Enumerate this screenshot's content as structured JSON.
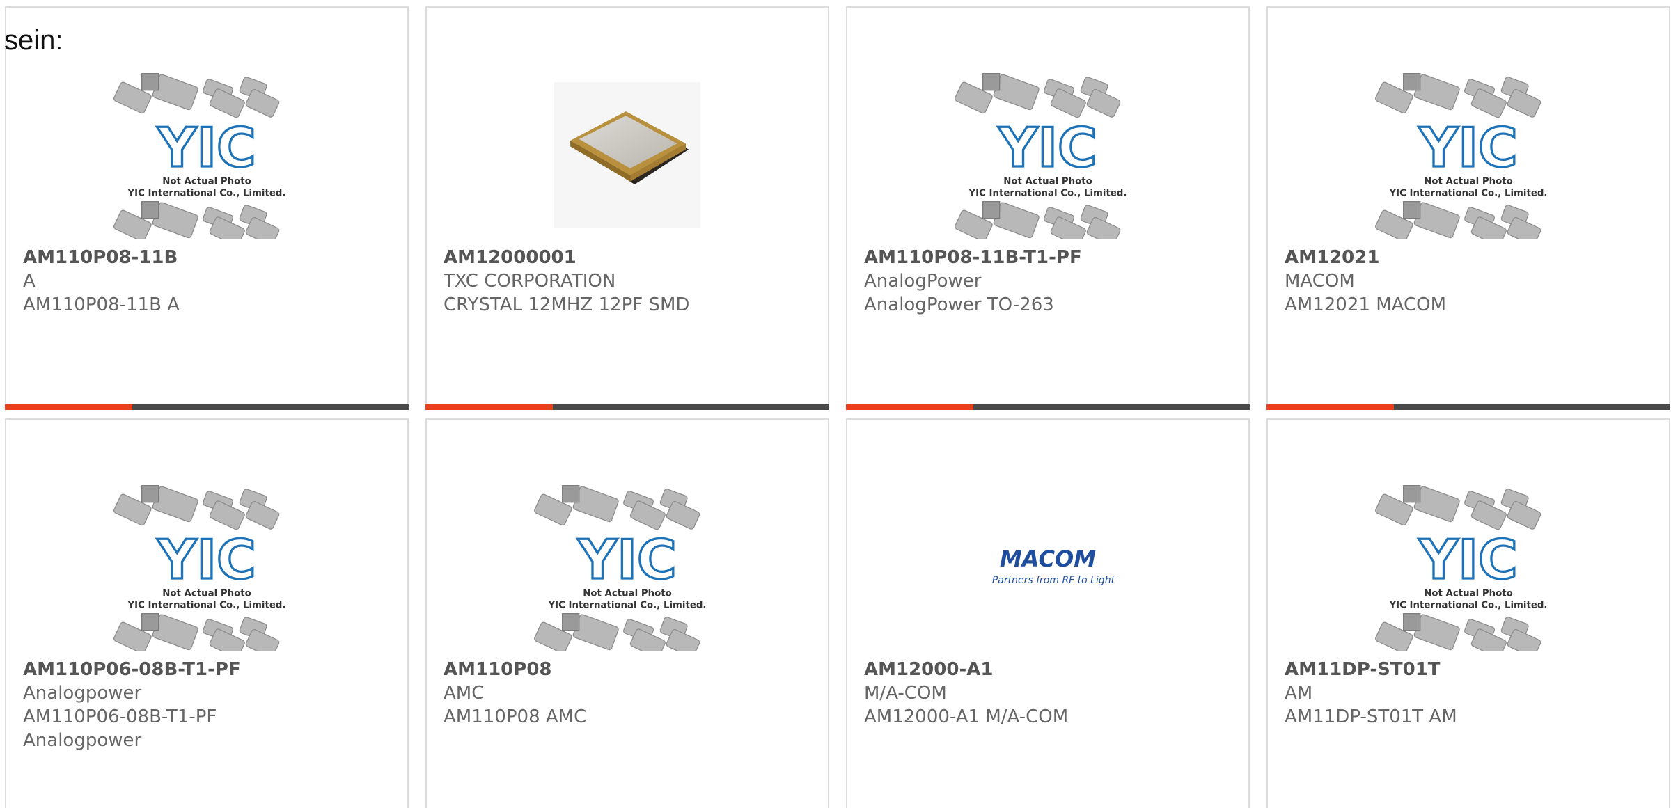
{
  "header_text": "sein:",
  "colors": {
    "accent": "#e8411c",
    "bar_dark": "#4a4a4a",
    "border": "#dcdcdc",
    "yic_blue": "#1e73b8",
    "macom_blue": "#1f4e9e"
  },
  "placeholder": {
    "line1": "Not Actual Photo",
    "line2": "YIC International Co., Limited.",
    "logo": "YIC"
  },
  "macom": {
    "name": "MACOM",
    "tagline": "Partners from RF to Light"
  },
  "products": [
    {
      "title": "AM110P08-11B",
      "line1": "A",
      "line2": "AM110P08-11B A",
      "line3": "",
      "image": "yic-placeholder"
    },
    {
      "title": "AM12000001",
      "line1": "TXC CORPORATION",
      "line2": "CRYSTAL 12MHZ 12PF SMD",
      "line3": "",
      "image": "crystal"
    },
    {
      "title": "AM110P08-11B-T1-PF",
      "line1": "AnalogPower",
      "line2": "AnalogPower TO-263",
      "line3": "",
      "image": "yic-placeholder"
    },
    {
      "title": "AM12021",
      "line1": "MACOM",
      "line2": "AM12021 MACOM",
      "line3": "",
      "image": "yic-placeholder"
    },
    {
      "title": "AM110P06-08B-T1-PF",
      "line1": "Analogpower",
      "line2": "AM110P06-08B-T1-PF",
      "line3": "Analogpower",
      "image": "yic-placeholder"
    },
    {
      "title": "AM110P08",
      "line1": "AMC",
      "line2": "AM110P08 AMC",
      "line3": "",
      "image": "yic-placeholder"
    },
    {
      "title": "AM12000-A1",
      "line1": "M/A-COM",
      "line2": "AM12000-A1 M/A-COM",
      "line3": "",
      "image": "macom-logo"
    },
    {
      "title": "AM11DP-ST01T",
      "line1": "AM",
      "line2": "AM11DP-ST01T AM",
      "line3": "",
      "image": "yic-placeholder"
    }
  ]
}
